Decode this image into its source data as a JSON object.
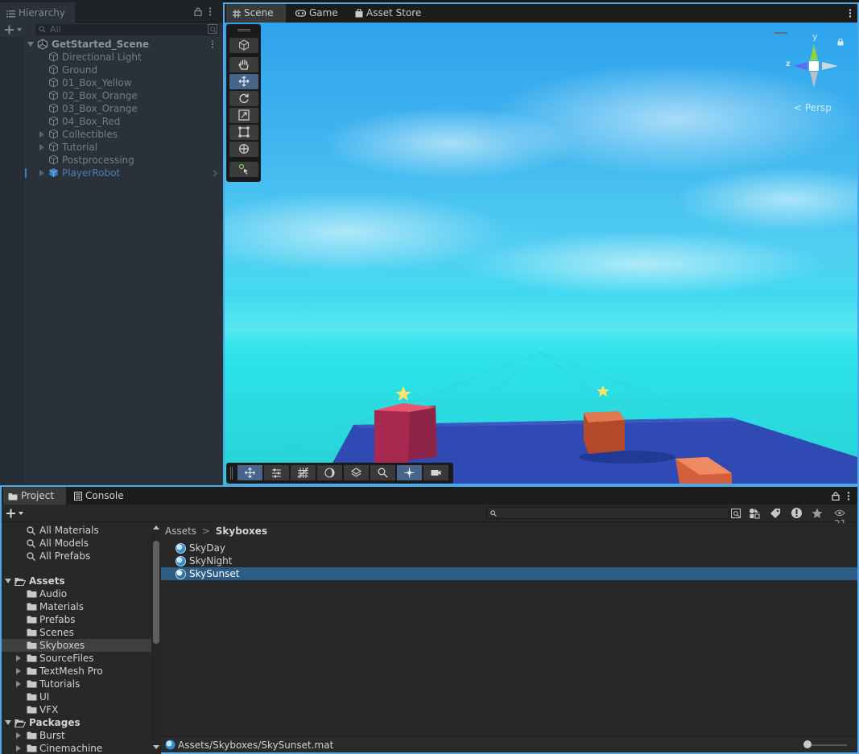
{
  "hierarchy": {
    "tab_label": "Hierarchy",
    "search_placeholder": "All",
    "scene_name": "GetStarted_Scene",
    "items": [
      {
        "label": "Directional Light",
        "expandable": false
      },
      {
        "label": "Ground",
        "expandable": false
      },
      {
        "label": "01_Box_Yellow",
        "expandable": false
      },
      {
        "label": "02_Box_Orange",
        "expandable": false
      },
      {
        "label": "03_Box_Orange",
        "expandable": false
      },
      {
        "label": "04_Box_Red",
        "expandable": false
      },
      {
        "label": "Collectibles",
        "expandable": true
      },
      {
        "label": "Tutorial",
        "expandable": true
      },
      {
        "label": "Postprocessing",
        "expandable": false
      },
      {
        "label": "PlayerRobot",
        "expandable": true,
        "prefab": true
      }
    ]
  },
  "scene_view": {
    "tabs": [
      {
        "label": "Scene",
        "icon": "grid-icon",
        "active": true
      },
      {
        "label": "Game",
        "icon": "gamepad-icon",
        "active": false
      },
      {
        "label": "Asset Store",
        "icon": "shopping-bag-icon",
        "active": false
      }
    ],
    "gizmo": {
      "y_label": "y",
      "z_label": "z",
      "projection_label": "Persp"
    },
    "tools": [
      "view-tool",
      "hand-tool",
      "move-tool",
      "rotate-tool",
      "scale-tool",
      "rect-tool",
      "transform-tool",
      "custom-tool"
    ],
    "active_tool": "move-tool",
    "bottom_tools": [
      "move-grid",
      "snapping",
      "grid",
      "shading",
      "layers",
      "search",
      "pivot",
      "camera"
    ]
  },
  "project": {
    "tabs": [
      {
        "label": "Project",
        "icon": "folder-icon",
        "active": true
      },
      {
        "label": "Console",
        "icon": "console-icon",
        "active": false
      }
    ],
    "hidden_count": "21",
    "favorites": [
      "All Materials",
      "All Models",
      "All Prefabs"
    ],
    "assets_label": "Assets",
    "asset_folders": [
      {
        "label": "Audio",
        "expandable": false
      },
      {
        "label": "Materials",
        "expandable": false
      },
      {
        "label": "Prefabs",
        "expandable": false
      },
      {
        "label": "Scenes",
        "expandable": false
      },
      {
        "label": "Skyboxes",
        "expandable": false,
        "selected": true
      },
      {
        "label": "SourceFiles",
        "expandable": true
      },
      {
        "label": "TextMesh Pro",
        "expandable": true
      },
      {
        "label": "Tutorials",
        "expandable": true
      },
      {
        "label": "UI",
        "expandable": false
      },
      {
        "label": "VFX",
        "expandable": false
      }
    ],
    "packages_label": "Packages",
    "package_folders": [
      {
        "label": "Burst",
        "expandable": true
      },
      {
        "label": "Cinemachine",
        "expandable": true
      }
    ],
    "breadcrumb": {
      "root": "Assets",
      "separator": ">",
      "current": "Skyboxes"
    },
    "files": [
      {
        "label": "SkyDay",
        "selected": false
      },
      {
        "label": "SkyNight",
        "selected": false
      },
      {
        "label": "SkySunset",
        "selected": true
      }
    ],
    "status_path": "Assets/Skyboxes/SkySunset.mat",
    "zoom_level": 0.0
  }
}
